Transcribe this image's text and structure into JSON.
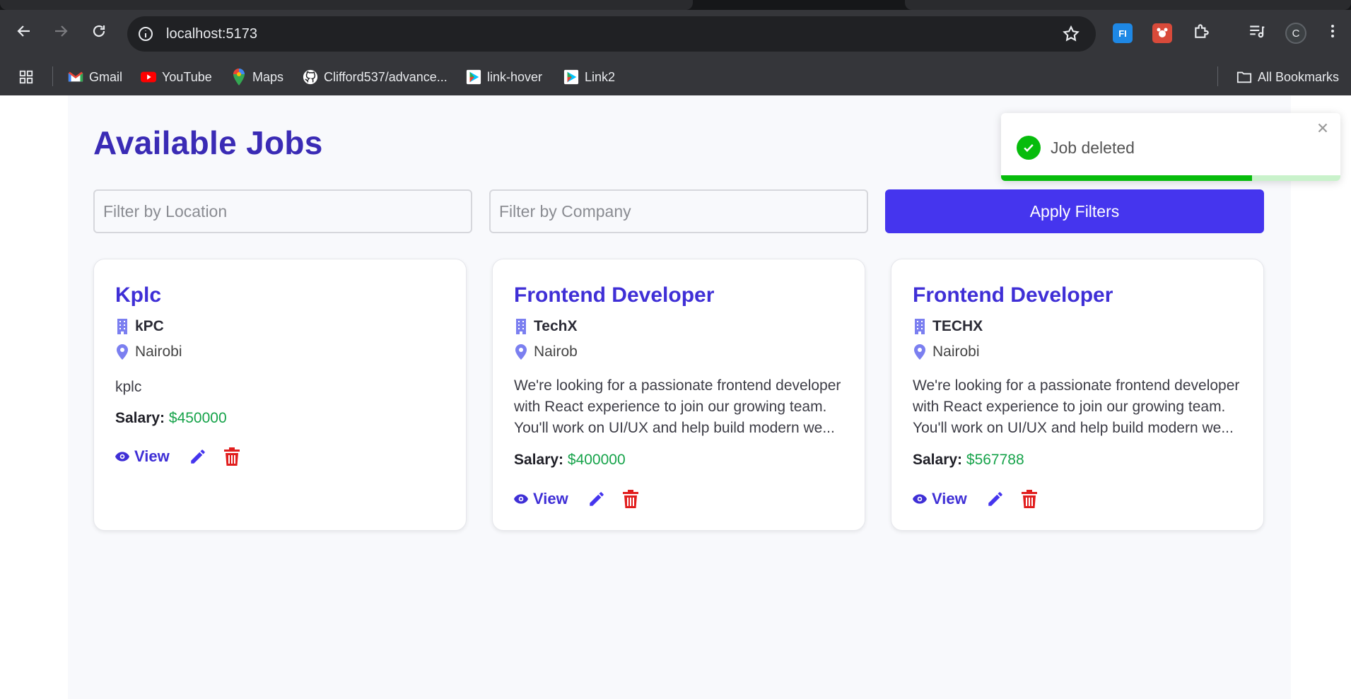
{
  "browser": {
    "url": "localhost:5173",
    "profile_initial": "C",
    "bookmarks": [
      {
        "label": "Gmail",
        "icon": "gmail-icon"
      },
      {
        "label": "YouTube",
        "icon": "youtube-icon"
      },
      {
        "label": "Maps",
        "icon": "maps-icon"
      },
      {
        "label": "Clifford537/advance...",
        "icon": "github-icon"
      },
      {
        "label": "link-hover",
        "icon": "play-icon"
      },
      {
        "label": "Link2",
        "icon": "play-icon"
      }
    ],
    "all_bookmarks_label": "All Bookmarks",
    "extensions": [
      {
        "label": "FI",
        "color": "#3b82f6"
      },
      {
        "label": "",
        "color": "#c0392b"
      }
    ]
  },
  "page": {
    "title": "Available Jobs",
    "filters": {
      "location_placeholder": "Filter by Location",
      "company_placeholder": "Filter by Company",
      "apply_label": "Apply Filters"
    }
  },
  "jobs": [
    {
      "title": "Kplc",
      "company": "kPC",
      "location": "Nairobi",
      "description": "kplc",
      "salary_label": "Salary:",
      "salary": "$450000",
      "view_label": "View"
    },
    {
      "title": "Frontend Developer",
      "company": "TechX",
      "location": "Nairob",
      "description": "We're looking for a passionate frontend developer with React experience to join our growing team. You'll work on UI/UX and help build modern we...",
      "salary_label": "Salary:",
      "salary": "$400000",
      "view_label": "View"
    },
    {
      "title": "Frontend Developer",
      "company": "TECHX",
      "location": "Nairobi",
      "description": "We're looking for a passionate frontend developer with React experience to join our growing team. You'll work on UI/UX and help build modern we...",
      "salary_label": "Salary:",
      "salary": "$567788",
      "view_label": "View"
    }
  ],
  "toast": {
    "message": "Job deleted",
    "progress": 0.74
  },
  "colors": {
    "title": "#3a2bb5",
    "accent": "#4535ee",
    "salary": "#16a34a",
    "delete": "#e11d1d",
    "success": "#07bc0c"
  }
}
